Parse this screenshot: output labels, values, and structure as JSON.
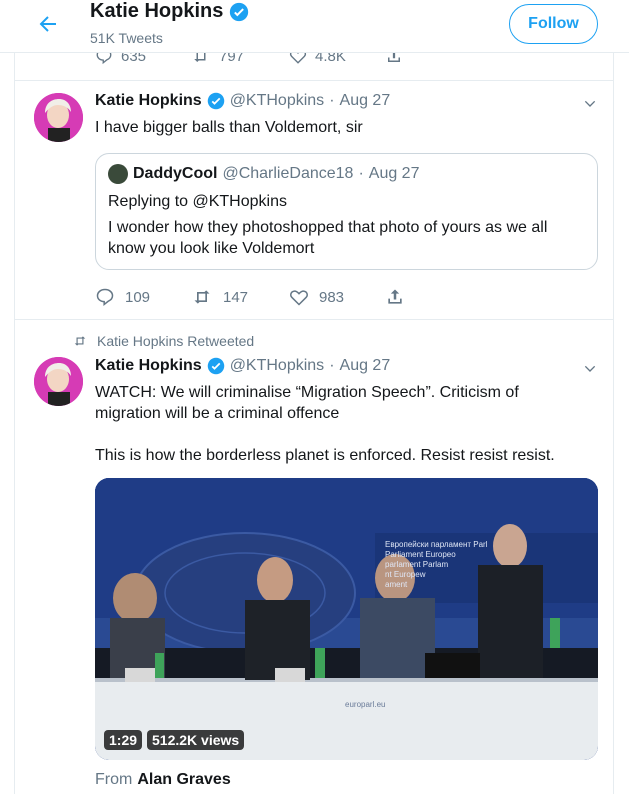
{
  "header": {
    "name": "Katie Hopkins",
    "tweets_count": "51K Tweets",
    "follow_label": "Follow"
  },
  "prev_tweet_stats": {
    "replies": "635",
    "retweets": "797",
    "likes": "4.8K"
  },
  "tweet1": {
    "name": "Katie Hopkins",
    "handle": "@KTHopkins",
    "date": "Aug 27",
    "text": "I have bigger balls than Voldemort, sir",
    "quote": {
      "name": "DaddyCool",
      "handle": "@CharlieDance18",
      "date": "Aug 27",
      "replying_to": "Replying to @KTHopkins",
      "text": "I wonder how they photoshopped that photo of yours as we all know you look like Voldemort"
    },
    "replies": "109",
    "retweets": "147",
    "likes": "983"
  },
  "tweet2": {
    "retweeted_by": "Katie Hopkins Retweeted",
    "name": "Katie Hopkins",
    "handle": "@KTHopkins",
    "date": "Aug 27",
    "text_line1": "WATCH: We will criminalise “Migration Speech”. Criticism of migration will be a criminal offence",
    "text_line2": "This is how the borderless planet is enforced. Resist resist resist.",
    "video": {
      "duration": "1:29",
      "views": "512.2K views",
      "banner_text": "Европейски парламент Parl\nParliament Europeo\nparlament Parlam\nnt Europew\nament",
      "watermark": "europarl.eu"
    },
    "from_label": "From",
    "from_name": "Alan Graves"
  },
  "colors": {
    "accent": "#1da1f2",
    "muted": "#657786",
    "avatar_bg": "#d63bb5"
  }
}
